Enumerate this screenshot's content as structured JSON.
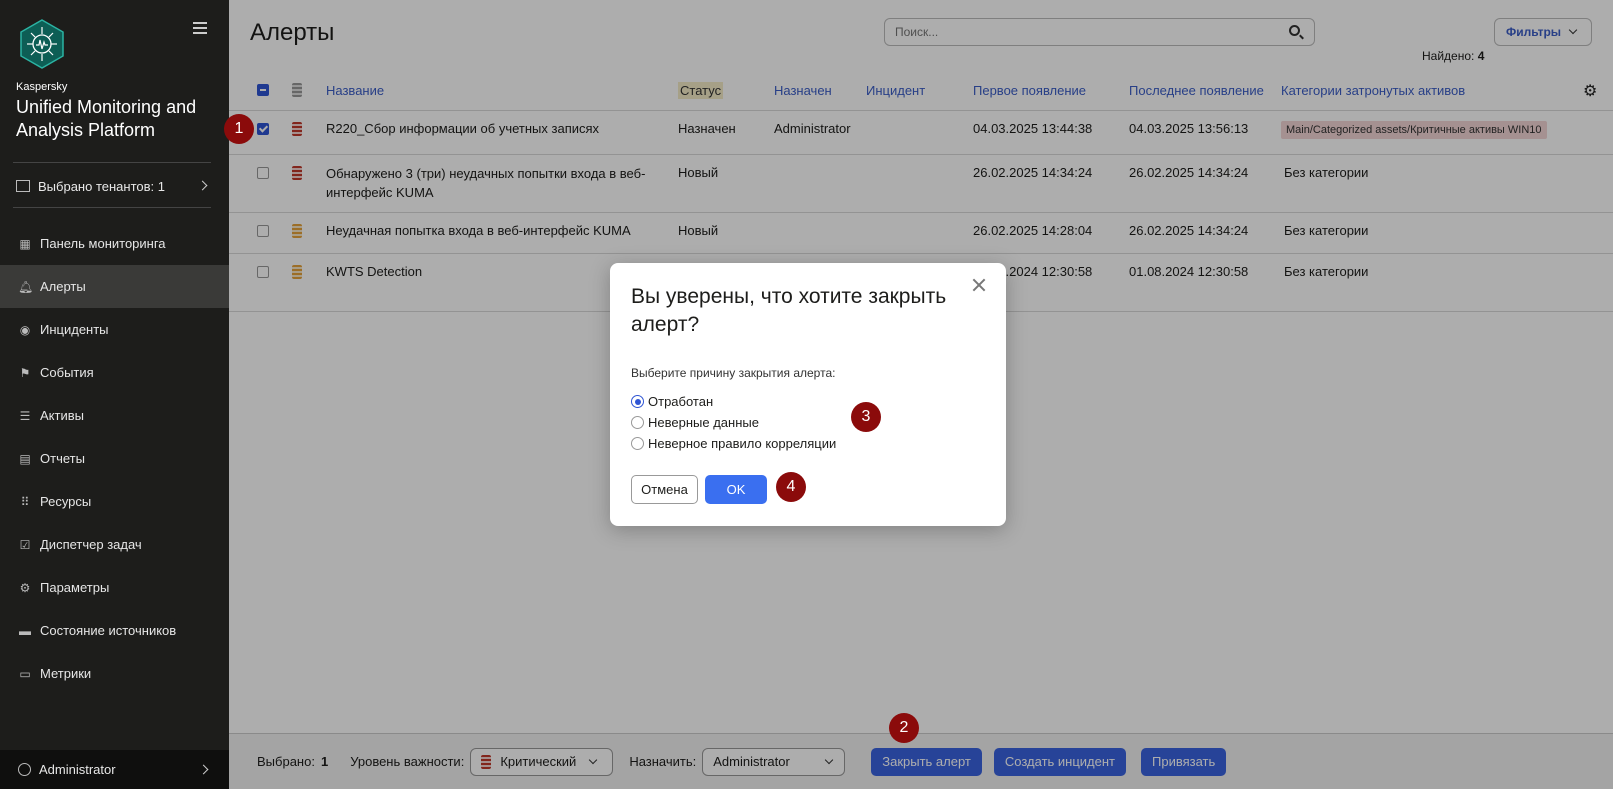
{
  "sidebar": {
    "brand_small": "Kaspersky",
    "brand_title": "Unified Monitoring and Analysis Platform",
    "tenant_label": "Выбрано тенантов: 1",
    "items": [
      {
        "label": "Панель мониторинга",
        "icon": "dashboard-icon"
      },
      {
        "label": "Алерты",
        "icon": "bell-icon",
        "active": true
      },
      {
        "label": "Инциденты",
        "icon": "eye-icon"
      },
      {
        "label": "События",
        "icon": "flag-icon"
      },
      {
        "label": "Активы",
        "icon": "assets-icon"
      },
      {
        "label": "Отчеты",
        "icon": "report-icon"
      },
      {
        "label": "Ресурсы",
        "icon": "grid-icon"
      },
      {
        "label": "Диспетчер задач",
        "icon": "clipboard-icon"
      },
      {
        "label": "Параметры",
        "icon": "gear-icon"
      },
      {
        "label": "Состояние источников",
        "icon": "source-icon"
      },
      {
        "label": "Метрики",
        "icon": "monitor-icon"
      }
    ],
    "user": "Administrator"
  },
  "header": {
    "title": "Алерты",
    "search_placeholder": "Поиск...",
    "filters_label": "Фильтры",
    "found_label": "Найдено:",
    "found_count": "4"
  },
  "table": {
    "columns": [
      "Название",
      "Статус",
      "Назначен",
      "Инцидент",
      "Первое появление",
      "Последнее появление",
      "Категории затронутых активов"
    ],
    "rows": [
      {
        "name": "R220_Сбор информации об учетных записях",
        "status": "Назначен",
        "assignee": "Administrator",
        "incident": "",
        "first": "04.03.2025 13:44:38",
        "last": "04.03.2025 13:56:13",
        "category": "Main/Categorized assets/Критичные активы WIN10",
        "severity": "critical",
        "checked": true
      },
      {
        "name": "Обнаружено 3 (три) неудачных попытки входа в веб-интерфейс KUMA",
        "status": "Новый",
        "assignee": "",
        "incident": "",
        "first": "26.02.2025 14:34:24",
        "last": "26.02.2025 14:34:24",
        "category": "Без категории",
        "severity": "critical",
        "checked": false
      },
      {
        "name": "Неудачная попытка входа в веб-интерфейс KUMA",
        "status": "Новый",
        "assignee": "",
        "incident": "",
        "first": "26.02.2025 14:28:04",
        "last": "26.02.2025 14:34:24",
        "category": "Без категории",
        "severity": "medium",
        "checked": false
      },
      {
        "name": "KWTS Detection",
        "status": "",
        "assignee": "",
        "incident": "",
        "first": "01.08.2024 12:30:58",
        "last": "01.08.2024 12:30:58",
        "category": "Без категории",
        "severity": "medium",
        "checked": false
      }
    ]
  },
  "bottombar": {
    "selected_label": "Выбрано:",
    "selected_count": "1",
    "severity_label": "Уровень важности:",
    "severity_value": "Критический",
    "assign_label": "Назначить:",
    "assign_value": "Administrator",
    "close_btn": "Закрыть алерт",
    "create_incident_btn": "Создать инцидент",
    "link_btn": "Привязать"
  },
  "dialog": {
    "title": "Вы уверены, что хотите закрыть алерт?",
    "reason_label": "Выберите причину закрытия алерта:",
    "options": [
      "Отработан",
      "Неверные данные",
      "Неверное правило корреляции"
    ],
    "selected_option": 0,
    "cancel": "Отмена",
    "ok": "OK"
  },
  "markers": [
    "1",
    "2",
    "3",
    "4"
  ],
  "colors": {
    "accent": "#3a63e0",
    "marker": "#8b0b0b",
    "sidebar": "#1d1d1b"
  }
}
